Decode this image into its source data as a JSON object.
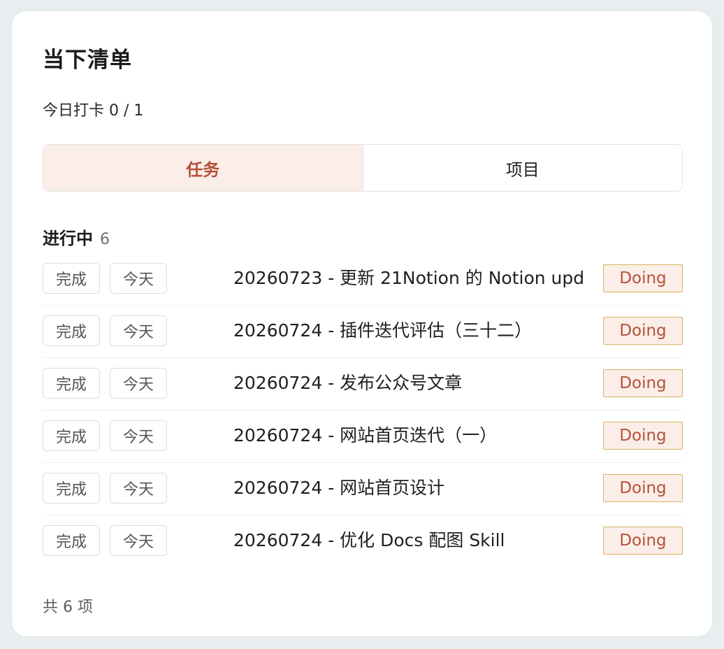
{
  "panel": {
    "title": "当下清单",
    "checkin": "今日打卡 0 / 1"
  },
  "tabs": [
    {
      "label": "任务",
      "active": true
    },
    {
      "label": "项目",
      "active": false
    }
  ],
  "section": {
    "label": "进行中",
    "count": "6"
  },
  "actions": {
    "done_label": "完成",
    "today_label": "今天"
  },
  "tasks": [
    {
      "title": "20260723 - 更新 21Notion 的 Notion upd",
      "status": "Doing"
    },
    {
      "title": "20260724 - 插件迭代评估（三十二）",
      "status": "Doing"
    },
    {
      "title": "20260724 - 发布公众号文章",
      "status": "Doing"
    },
    {
      "title": "20260724 - 网站首页迭代（一）",
      "status": "Doing"
    },
    {
      "title": "20260724 - 网站首页设计",
      "status": "Doing"
    },
    {
      "title": "20260724 - 优化 Docs 配图 Skill",
      "status": "Doing"
    }
  ],
  "footer": {
    "total": "共 6 项"
  },
  "colors": {
    "accent": "#b5503a",
    "accent_bg": "#fbeee8",
    "status_border": "#d9b25f"
  }
}
